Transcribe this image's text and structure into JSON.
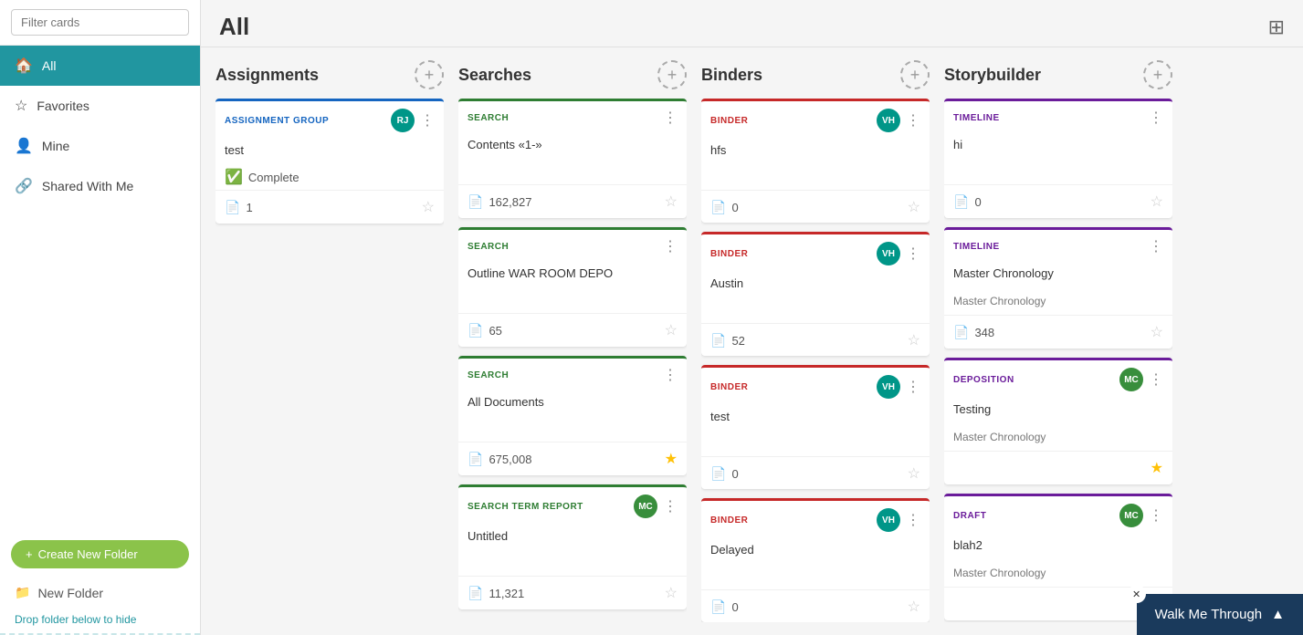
{
  "sidebar": {
    "filter_placeholder": "Filter cards",
    "nav_items": [
      {
        "id": "all",
        "label": "All",
        "icon": "🏠",
        "active": true
      },
      {
        "id": "favorites",
        "label": "Favorites",
        "icon": "☆"
      },
      {
        "id": "mine",
        "label": "Mine",
        "icon": "👤"
      },
      {
        "id": "shared",
        "label": "Shared With Me",
        "icon": "🔗"
      }
    ],
    "create_btn": "Create New Folder",
    "new_folder_label": "New Folder",
    "drop_hint": "Drop folder below to hide"
  },
  "main": {
    "title": "All",
    "columns": [
      {
        "id": "assignments",
        "title": "Assignments",
        "cards": [
          {
            "type": "ASSIGNMENT GROUP",
            "type_key": "assignment",
            "title": "test",
            "status": "Complete",
            "count": "1",
            "avatar_initials": "RJ",
            "avatar_color": "teal",
            "starred": false
          }
        ]
      },
      {
        "id": "searches",
        "title": "Searches",
        "cards": [
          {
            "type": "SEARCH",
            "type_key": "search",
            "title": "Contents «1-»",
            "count": "162,827",
            "avatar_initials": null,
            "avatar_color": null,
            "starred": false
          },
          {
            "type": "SEARCH",
            "type_key": "search",
            "title": "Outline WAR ROOM DEPO",
            "count": "65",
            "avatar_initials": null,
            "avatar_color": null,
            "starred": false
          },
          {
            "type": "SEARCH",
            "type_key": "search",
            "title": "All Documents",
            "count": "675,008",
            "avatar_initials": null,
            "avatar_color": null,
            "starred": true
          },
          {
            "type": "SEARCH TERM REPORT",
            "type_key": "search-term",
            "title": "Untitled",
            "count": "11,321",
            "avatar_initials": "MC",
            "avatar_color": "green",
            "starred": false
          }
        ]
      },
      {
        "id": "binders",
        "title": "Binders",
        "cards": [
          {
            "type": "BINDER",
            "type_key": "binder",
            "title": "hfs",
            "count": "0",
            "avatar_initials": "VH",
            "avatar_color": "teal",
            "starred": false
          },
          {
            "type": "BINDER",
            "type_key": "binder",
            "title": "Austin",
            "count": "52",
            "avatar_initials": "VH",
            "avatar_color": "teal",
            "starred": false
          },
          {
            "type": "BINDER",
            "type_key": "binder",
            "title": "test",
            "count": "0",
            "avatar_initials": "VH",
            "avatar_color": "teal",
            "starred": false
          },
          {
            "type": "BINDER",
            "type_key": "binder",
            "title": "Delayed",
            "count": "0",
            "avatar_initials": "VH",
            "avatar_color": "teal",
            "starred": false
          }
        ]
      },
      {
        "id": "storybuilder",
        "title": "Storybuilder",
        "cards": [
          {
            "type": "TIMELINE",
            "type_key": "timeline",
            "title": "hi",
            "subtitle": null,
            "count": "0",
            "avatar_initials": null,
            "avatar_color": null,
            "starred": false
          },
          {
            "type": "TIMELINE",
            "type_key": "timeline",
            "title": "Master Chronology",
            "subtitle": "Master Chronology",
            "count": "348",
            "avatar_initials": null,
            "avatar_color": null,
            "starred": false
          },
          {
            "type": "DEPOSITION",
            "type_key": "deposition",
            "title": "Testing",
            "subtitle": "Master Chronology",
            "count": null,
            "avatar_initials": "MC",
            "avatar_color": "green",
            "starred": true
          },
          {
            "type": "DRAFT",
            "type_key": "draft",
            "title": "blah2",
            "subtitle": "Master Chronology",
            "count": null,
            "avatar_initials": "MC",
            "avatar_color": "green",
            "starred": false
          }
        ]
      }
    ]
  },
  "walk_me_through": {
    "label": "Walk Me Through",
    "chevron": "▲"
  }
}
